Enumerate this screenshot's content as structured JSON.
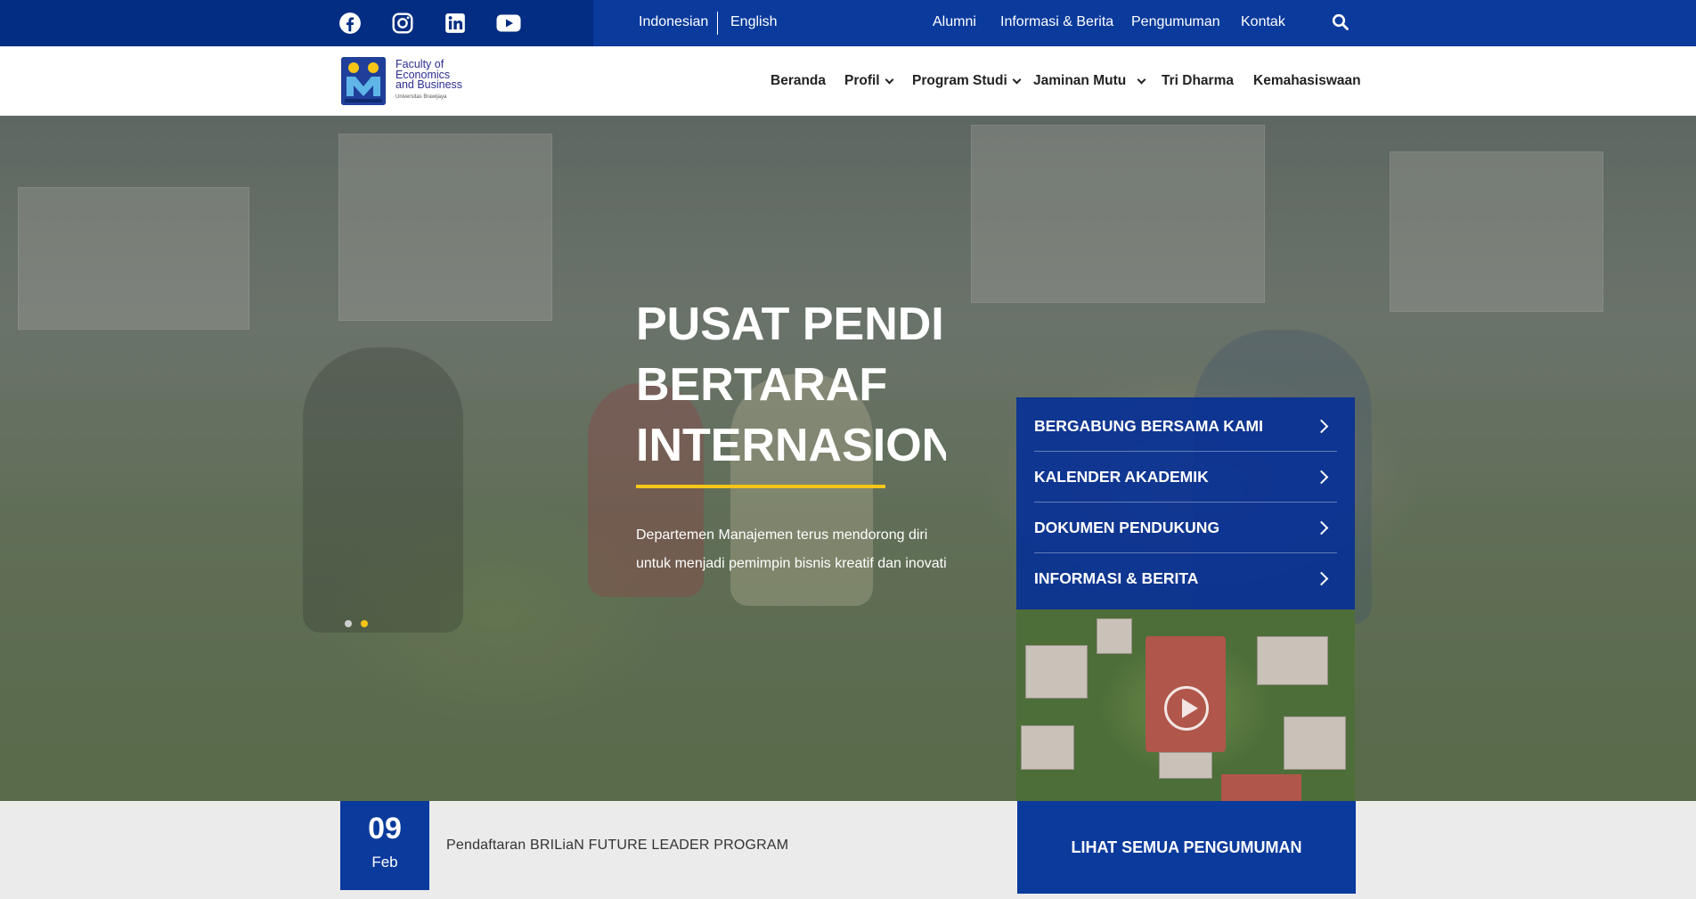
{
  "topbar": {
    "social": [
      {
        "icon": "facebook-icon"
      },
      {
        "icon": "instagram-icon"
      },
      {
        "icon": "linkedin-icon"
      },
      {
        "icon": "youtube-icon"
      }
    ],
    "languages": [
      "Indonesian",
      "English"
    ],
    "links": [
      "Alumni",
      "Informasi & Berita",
      "Pengumuman",
      "Kontak"
    ],
    "search_icon": "search-icon"
  },
  "logo": {
    "line1": "Faculty of",
    "line2": "Economics",
    "line3": "and Business",
    "line4": "Universitas Brawijaya"
  },
  "nav": {
    "items": [
      "Beranda",
      "Profil",
      "Program Studi",
      "Jaminan Mutu",
      "Tri Dharma",
      "Kemahasiswaan"
    ]
  },
  "hero": {
    "title_line1": "PUSAT PENDIDIKAN",
    "title_line2": "BERTARAF",
    "title_line3": "INTERNASIONAL",
    "desc_line1": "Departemen Manajemen terus mendorong diri",
    "desc_line2": "untuk menjadi pemimpin bisnis kreatif dan inovatif",
    "slides_total": 2,
    "active_slide": 2,
    "accent": "#f5c518"
  },
  "quick_menu": [
    "BERGABUNG BERSAMA KAMI",
    "KALENDER AKADEMIK",
    "DOKUMEN PENDUKUNG",
    "INFORMASI & BERITA"
  ],
  "announcement": {
    "day": "09",
    "month": "Feb",
    "text": "Pendaftaran BRILiaN FUTURE LEADER PROGRAM",
    "button": "LIHAT SEMUA PENGUMUMAN"
  },
  "colors": {
    "primary": "#0a3a9c",
    "accent": "#f5c518"
  }
}
